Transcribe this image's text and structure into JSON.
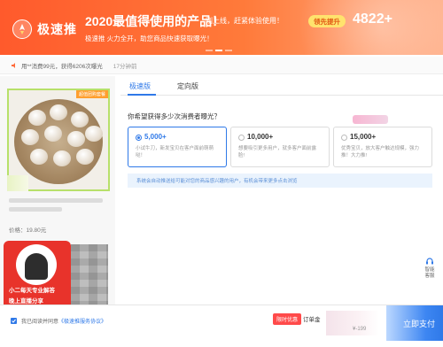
{
  "banner": {
    "logo_text": "极速推",
    "title": "2020最值得使用的产品！",
    "title_tail": "刚上线，赶紧体验使用！",
    "subtitle": "极速推 火力全开，助您商品快速获取曝光！",
    "pill": "领先提升",
    "count": "4822+"
  },
  "strip": {
    "text": "用**消费99元，获得6206次曝光",
    "time": "17分钟前"
  },
  "product": {
    "tag": "超值团购套餐",
    "price": "价格：19.80元"
  },
  "ad": {
    "line1": "小二每天专业解答",
    "line2": "晚上直播分享"
  },
  "tabs": [
    {
      "label": "极速版"
    },
    {
      "label": "定向版"
    }
  ],
  "question": "你希望获得多少次消费者曝光？",
  "options": [
    {
      "value": "5,000+",
      "desc": "小试牛刀，新发宝贝在客户面前萌萌哒！"
    },
    {
      "value": "10,000+",
      "desc": "想要吸引更多用户，就多客户面前露脸!"
    },
    {
      "value": "15,000+",
      "desc": "优秀宝贝，放大客户触达规模，强力推！大力推!"
    }
  ],
  "notice": "系统会自动推送给可能对您的商品感兴趣的用户，有机会带来更多点击浏览",
  "side": {
    "line1": "智能",
    "line2": "客服"
  },
  "footer": {
    "agree_prefix": "我已阅读并同意",
    "agree_link": "《极速推服务协议》",
    "badge": "限时优惠",
    "order": "订单金",
    "total": "¥-199",
    "pay": "立即支付"
  },
  "colors": {
    "accent": "#2f79e8",
    "banner": "#ff5a2c",
    "ad": "#e8332b"
  }
}
